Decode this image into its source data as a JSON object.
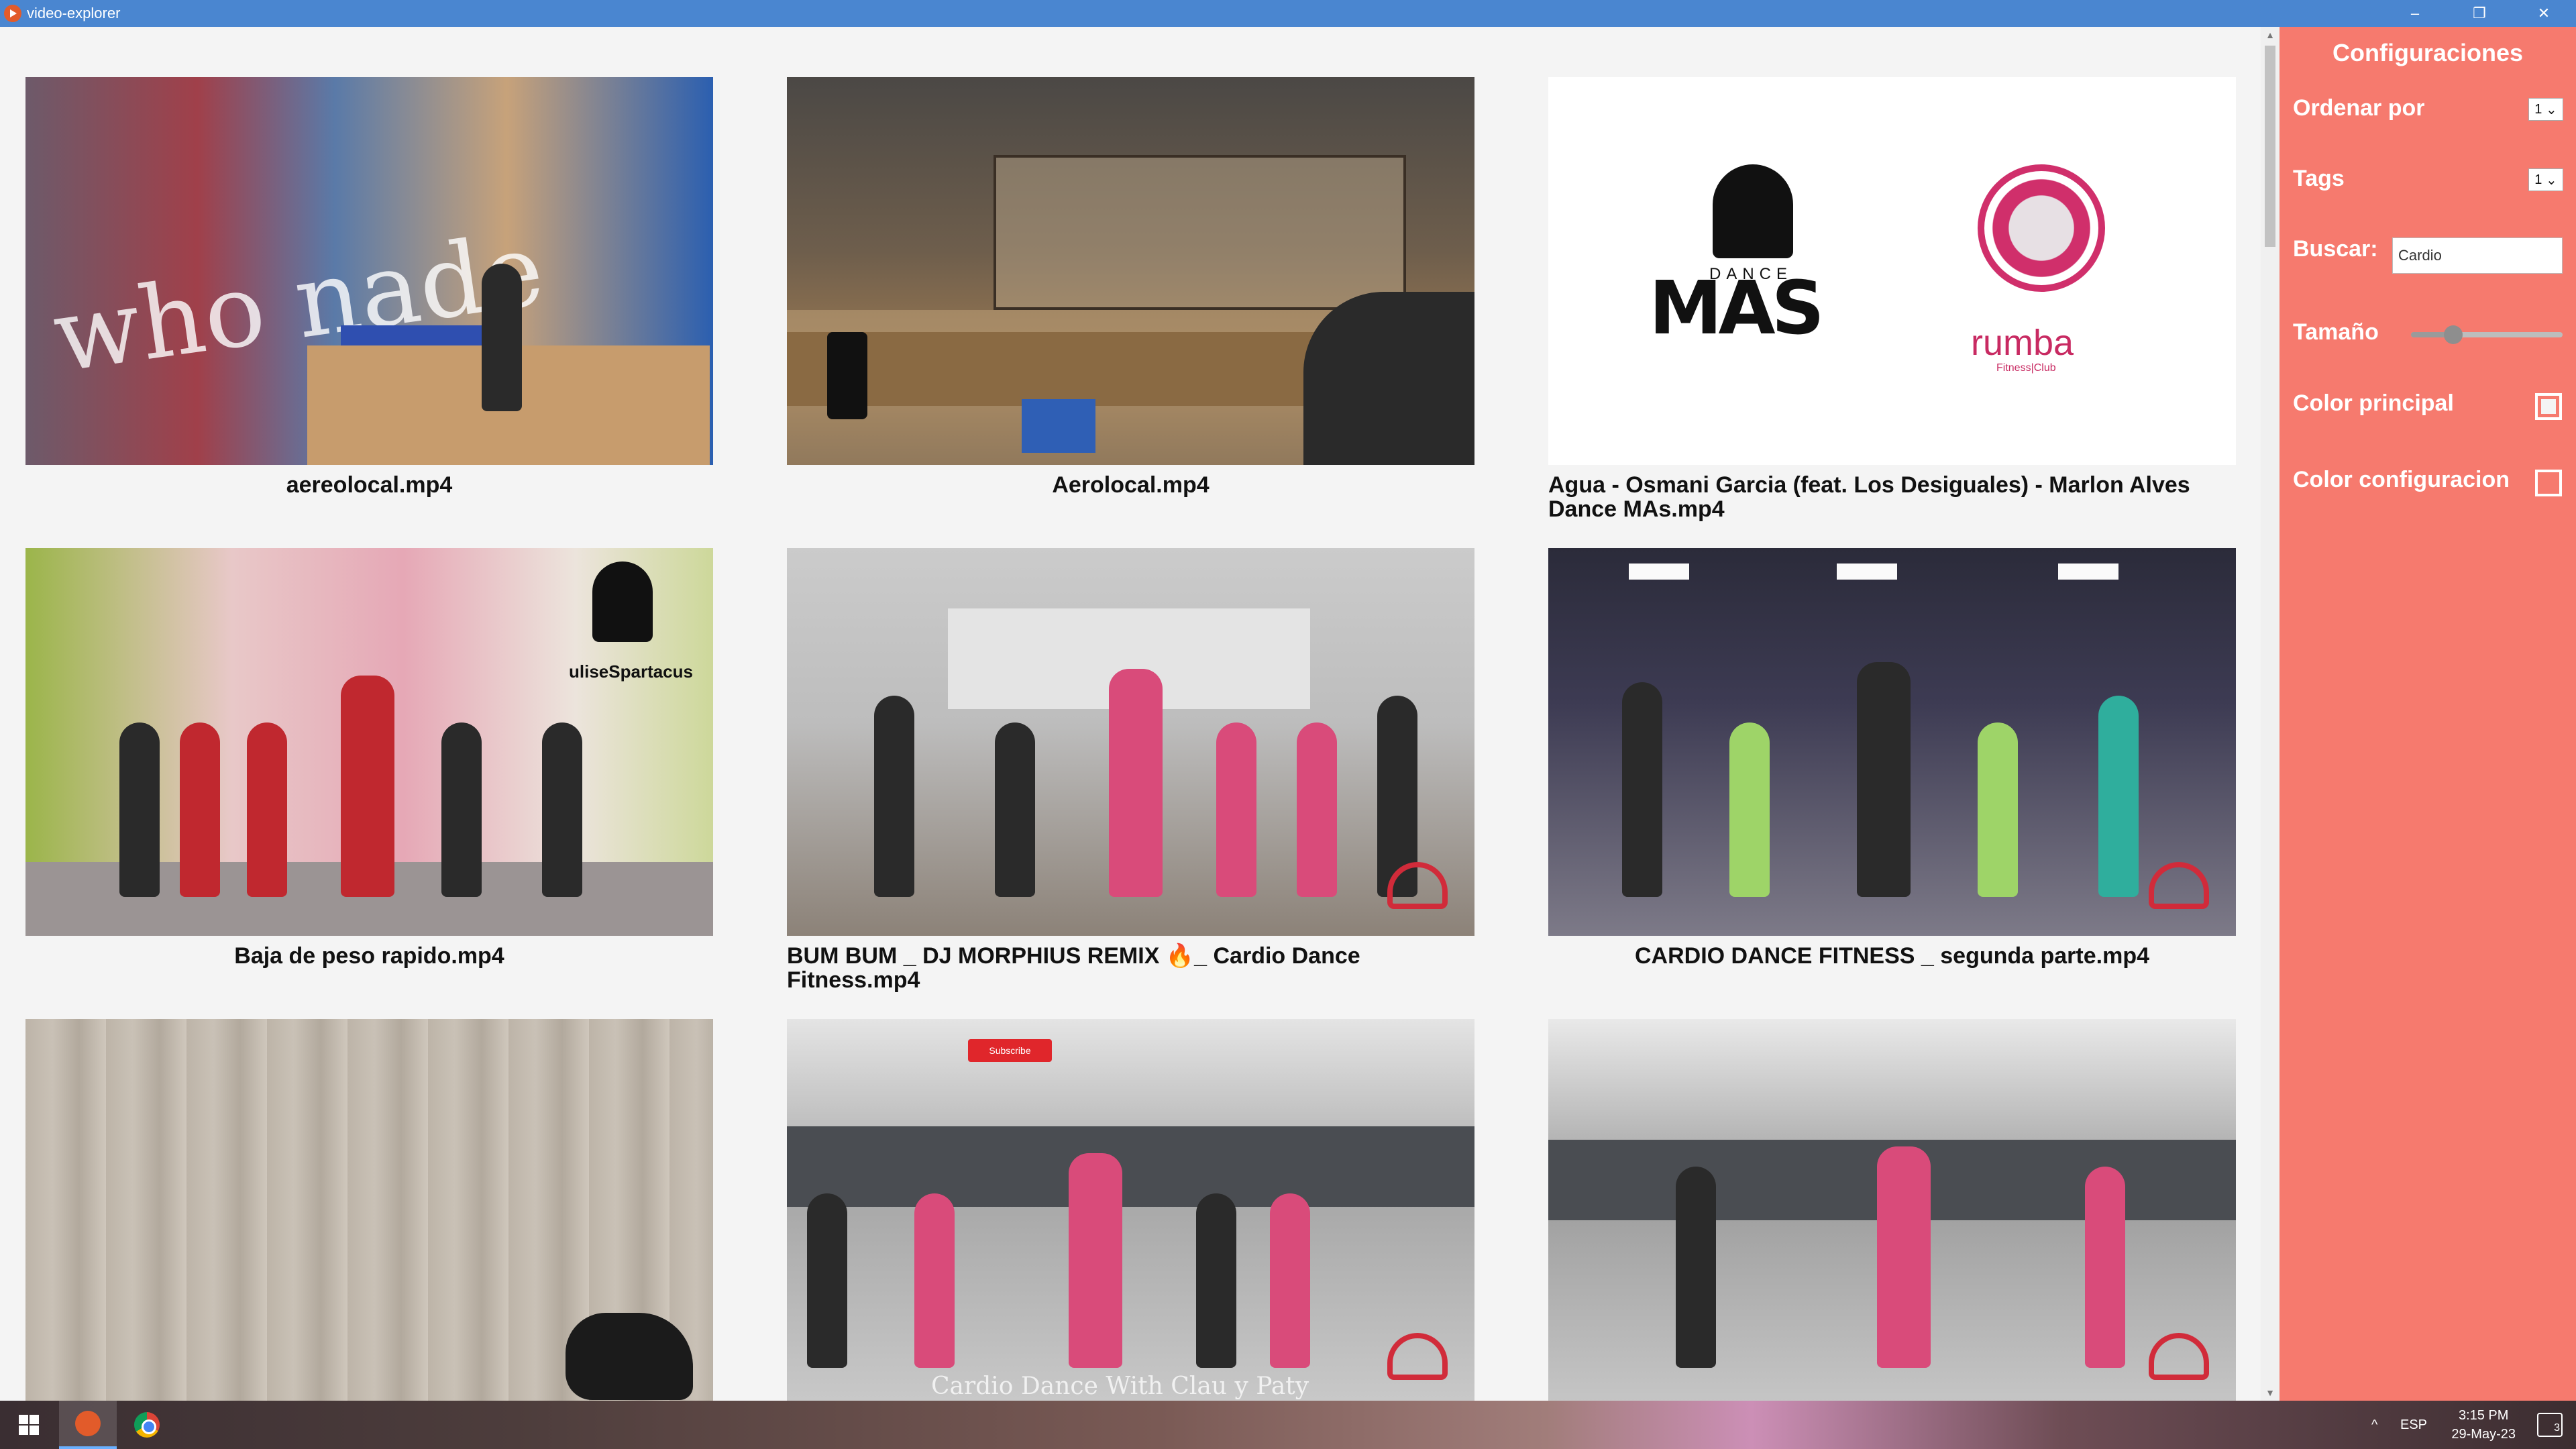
{
  "window": {
    "title": "video-explorer",
    "min_glyph": "–",
    "restore_glyph": "❐",
    "close_glyph": "✕"
  },
  "videos": [
    {
      "title": "aereolocal.mp4"
    },
    {
      "title": "Aerolocal.mp4"
    },
    {
      "title": "Agua - Osmani Garcia (feat. Los Desiguales) - Marlon Alves Dance MAs.mp4"
    },
    {
      "title": "Baja de peso rapido.mp4"
    },
    {
      "title": "BUM BUM _ DJ MORPHIUS REMIX 🔥_ Cardio Dance Fitness.mp4"
    },
    {
      "title": "CARDIO DANCE FITNESS _ segunda parte.mp4"
    },
    {
      "title": ""
    },
    {
      "title": ""
    },
    {
      "title": ""
    }
  ],
  "thumb_text": {
    "who_made": "who nade",
    "dance": "DANCE",
    "mas": "MAS",
    "rumba": "rumba",
    "rumba_sub": "Fitness|Club",
    "spartacus": "uliseSpartacus",
    "subscribe": "Subscribe",
    "overlay": "Cardio Dance With Clau y Paty"
  },
  "panel": {
    "title": "Configuraciones",
    "sort_label": "Ordenar por",
    "sort_value": "1",
    "tags_label": "Tags",
    "tags_value": "1",
    "search_label": "Buscar:",
    "search_value": "Cardio",
    "size_label": "Tamaño",
    "size_level": 0.28,
    "primary_color_label": "Color principal",
    "config_color_label": "Color configuracion"
  },
  "taskbar": {
    "tray_chevron": "^",
    "language": "ESP",
    "time": "3:15 PM",
    "date": "29-May-23",
    "notifications": "3"
  },
  "colors": {
    "titlebar": "#4a86d0",
    "panel": "#f67a6e",
    "content_bg": "#f4f4f4"
  }
}
